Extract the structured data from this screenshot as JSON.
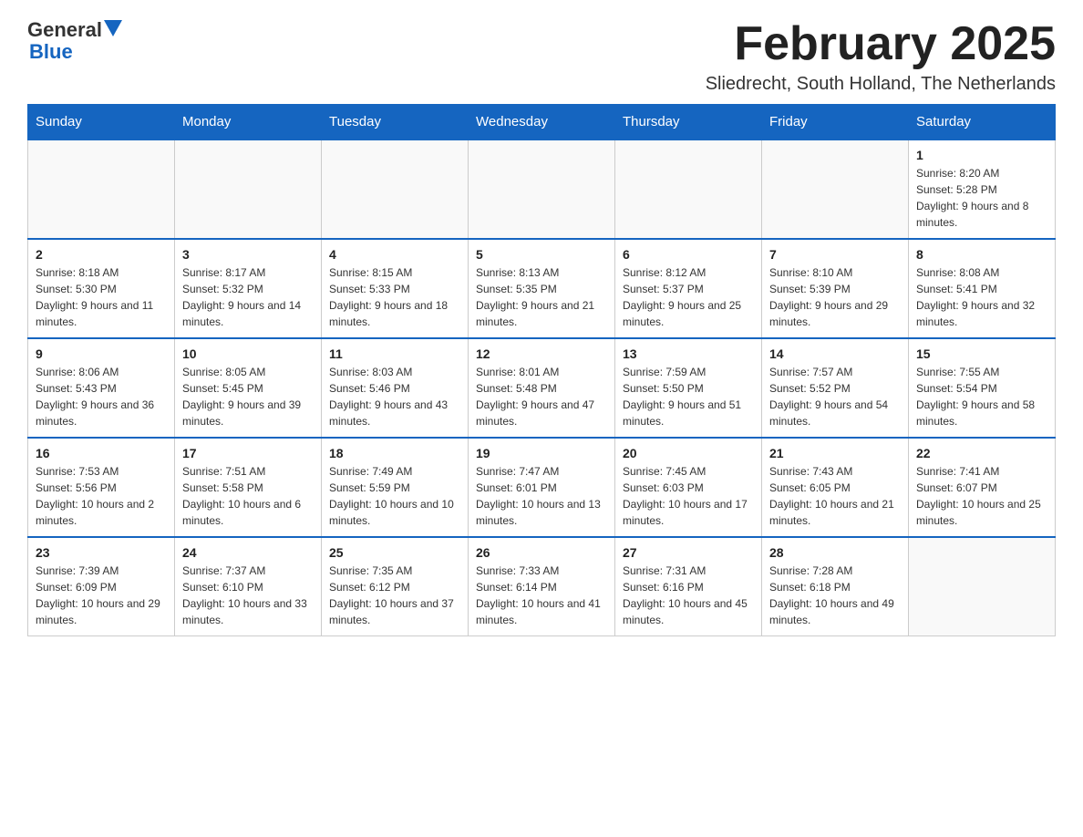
{
  "header": {
    "logo_general": "General",
    "logo_blue": "Blue",
    "month_title": "February 2025",
    "location": "Sliedrecht, South Holland, The Netherlands"
  },
  "weekdays": [
    "Sunday",
    "Monday",
    "Tuesday",
    "Wednesday",
    "Thursday",
    "Friday",
    "Saturday"
  ],
  "weeks": [
    [
      {
        "day": "",
        "info": ""
      },
      {
        "day": "",
        "info": ""
      },
      {
        "day": "",
        "info": ""
      },
      {
        "day": "",
        "info": ""
      },
      {
        "day": "",
        "info": ""
      },
      {
        "day": "",
        "info": ""
      },
      {
        "day": "1",
        "info": "Sunrise: 8:20 AM\nSunset: 5:28 PM\nDaylight: 9 hours and 8 minutes."
      }
    ],
    [
      {
        "day": "2",
        "info": "Sunrise: 8:18 AM\nSunset: 5:30 PM\nDaylight: 9 hours and 11 minutes."
      },
      {
        "day": "3",
        "info": "Sunrise: 8:17 AM\nSunset: 5:32 PM\nDaylight: 9 hours and 14 minutes."
      },
      {
        "day": "4",
        "info": "Sunrise: 8:15 AM\nSunset: 5:33 PM\nDaylight: 9 hours and 18 minutes."
      },
      {
        "day": "5",
        "info": "Sunrise: 8:13 AM\nSunset: 5:35 PM\nDaylight: 9 hours and 21 minutes."
      },
      {
        "day": "6",
        "info": "Sunrise: 8:12 AM\nSunset: 5:37 PM\nDaylight: 9 hours and 25 minutes."
      },
      {
        "day": "7",
        "info": "Sunrise: 8:10 AM\nSunset: 5:39 PM\nDaylight: 9 hours and 29 minutes."
      },
      {
        "day": "8",
        "info": "Sunrise: 8:08 AM\nSunset: 5:41 PM\nDaylight: 9 hours and 32 minutes."
      }
    ],
    [
      {
        "day": "9",
        "info": "Sunrise: 8:06 AM\nSunset: 5:43 PM\nDaylight: 9 hours and 36 minutes."
      },
      {
        "day": "10",
        "info": "Sunrise: 8:05 AM\nSunset: 5:45 PM\nDaylight: 9 hours and 39 minutes."
      },
      {
        "day": "11",
        "info": "Sunrise: 8:03 AM\nSunset: 5:46 PM\nDaylight: 9 hours and 43 minutes."
      },
      {
        "day": "12",
        "info": "Sunrise: 8:01 AM\nSunset: 5:48 PM\nDaylight: 9 hours and 47 minutes."
      },
      {
        "day": "13",
        "info": "Sunrise: 7:59 AM\nSunset: 5:50 PM\nDaylight: 9 hours and 51 minutes."
      },
      {
        "day": "14",
        "info": "Sunrise: 7:57 AM\nSunset: 5:52 PM\nDaylight: 9 hours and 54 minutes."
      },
      {
        "day": "15",
        "info": "Sunrise: 7:55 AM\nSunset: 5:54 PM\nDaylight: 9 hours and 58 minutes."
      }
    ],
    [
      {
        "day": "16",
        "info": "Sunrise: 7:53 AM\nSunset: 5:56 PM\nDaylight: 10 hours and 2 minutes."
      },
      {
        "day": "17",
        "info": "Sunrise: 7:51 AM\nSunset: 5:58 PM\nDaylight: 10 hours and 6 minutes."
      },
      {
        "day": "18",
        "info": "Sunrise: 7:49 AM\nSunset: 5:59 PM\nDaylight: 10 hours and 10 minutes."
      },
      {
        "day": "19",
        "info": "Sunrise: 7:47 AM\nSunset: 6:01 PM\nDaylight: 10 hours and 13 minutes."
      },
      {
        "day": "20",
        "info": "Sunrise: 7:45 AM\nSunset: 6:03 PM\nDaylight: 10 hours and 17 minutes."
      },
      {
        "day": "21",
        "info": "Sunrise: 7:43 AM\nSunset: 6:05 PM\nDaylight: 10 hours and 21 minutes."
      },
      {
        "day": "22",
        "info": "Sunrise: 7:41 AM\nSunset: 6:07 PM\nDaylight: 10 hours and 25 minutes."
      }
    ],
    [
      {
        "day": "23",
        "info": "Sunrise: 7:39 AM\nSunset: 6:09 PM\nDaylight: 10 hours and 29 minutes."
      },
      {
        "day": "24",
        "info": "Sunrise: 7:37 AM\nSunset: 6:10 PM\nDaylight: 10 hours and 33 minutes."
      },
      {
        "day": "25",
        "info": "Sunrise: 7:35 AM\nSunset: 6:12 PM\nDaylight: 10 hours and 37 minutes."
      },
      {
        "day": "26",
        "info": "Sunrise: 7:33 AM\nSunset: 6:14 PM\nDaylight: 10 hours and 41 minutes."
      },
      {
        "day": "27",
        "info": "Sunrise: 7:31 AM\nSunset: 6:16 PM\nDaylight: 10 hours and 45 minutes."
      },
      {
        "day": "28",
        "info": "Sunrise: 7:28 AM\nSunset: 6:18 PM\nDaylight: 10 hours and 49 minutes."
      },
      {
        "day": "",
        "info": ""
      }
    ]
  ]
}
